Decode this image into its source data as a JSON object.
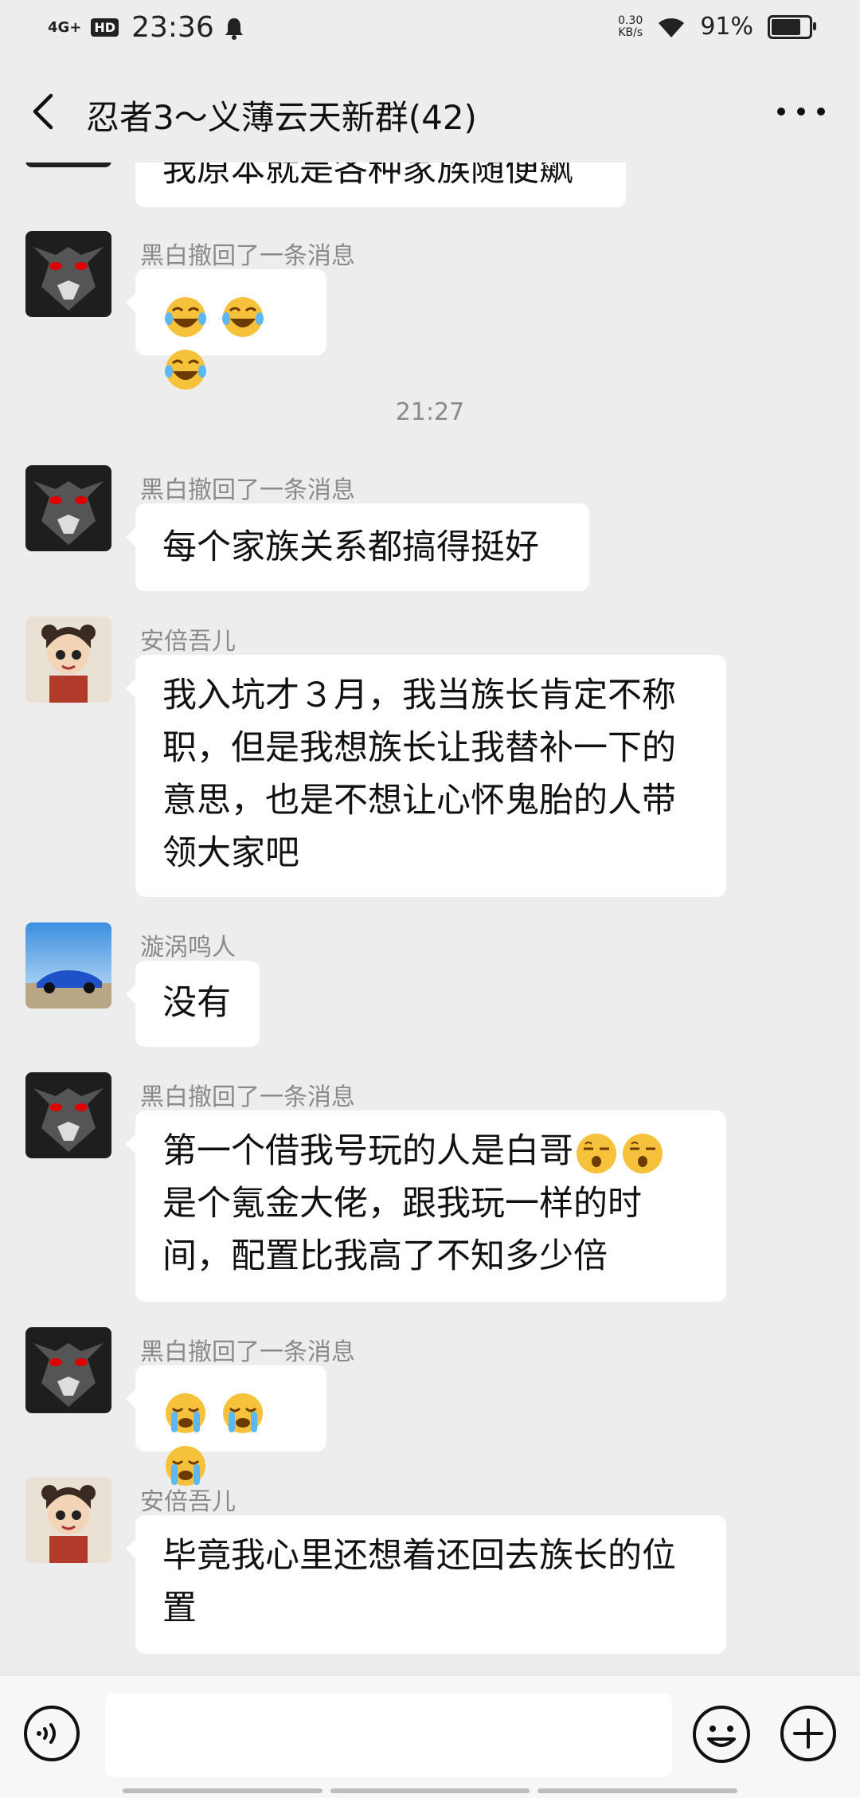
{
  "status_bar": {
    "signal": "4G+",
    "hd": "HD",
    "time": "23:36",
    "speed_value": "0.30",
    "speed_unit": "KB/s",
    "battery_percent": "91%",
    "battery_level": 0.91
  },
  "header": {
    "title": "忍者3～义薄云天新群(42)"
  },
  "messages": [
    {
      "sender": "",
      "text": "我原本就是各种家族随便飙",
      "avatar": "black-wolf"
    },
    {
      "sender": "黑白撤回了一条消息",
      "emoji": [
        "joy",
        "joy",
        "joy"
      ],
      "avatar": "black-wolf"
    },
    {
      "timestamp": "21:27"
    },
    {
      "sender": "黑白撤回了一条消息",
      "text": "每个家族关系都搞得挺好",
      "avatar": "black-wolf"
    },
    {
      "sender": "安倍吾儿",
      "lines": [
        "我入坑才３月，我当族长肯定不称",
        "职，但是我想族长让我替补一下的",
        "意思，也是不想让心怀鬼胎的人带",
        "领大家吧"
      ],
      "avatar": "anime-girl"
    },
    {
      "sender": "漩涡鸣人",
      "text": "没有",
      "avatar": "blue-car"
    },
    {
      "sender": "黑白撤回了一条消息",
      "lines": [
        "第一个借我号玩的人是白哥",
        "是个氪金大佬，跟我玩一样的时",
        "间，配置比我高了不知多少倍"
      ],
      "emoji": [
        "sleepy",
        "sleepy"
      ],
      "avatar": "black-wolf"
    },
    {
      "sender": "黑白撤回了一条消息",
      "emoji": [
        "cry",
        "cry",
        "cry"
      ],
      "avatar": "black-wolf"
    },
    {
      "sender": "安倍吾儿",
      "lines": [
        "毕竟我心里还想着还回去族长的位",
        "置"
      ],
      "avatar": "anime-girl"
    }
  ],
  "input_bar": {
    "placeholder": ""
  }
}
